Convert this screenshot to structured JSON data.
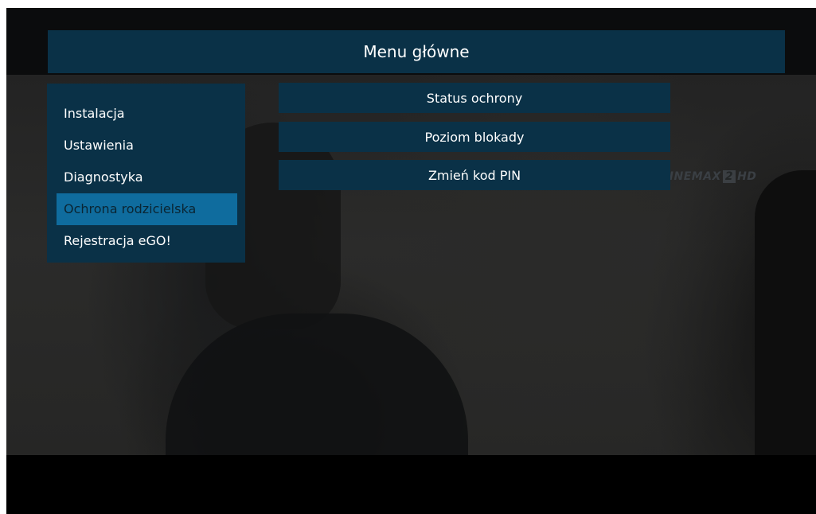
{
  "header": {
    "title": "Menu główne"
  },
  "sidebar": {
    "items": [
      {
        "label": "Instalacja"
      },
      {
        "label": "Ustawienia"
      },
      {
        "label": "Diagnostyka"
      },
      {
        "label": "Ochrona rodzicielska",
        "selected": true
      },
      {
        "label": "Rejestracja eGO!"
      }
    ]
  },
  "submenu": {
    "items": [
      {
        "label": "Status ochrony"
      },
      {
        "label": "Poziom blokady"
      },
      {
        "label": "Zmień kod PIN"
      }
    ]
  },
  "channel_logo": {
    "name": "CINEMAX",
    "number": "2",
    "suffix": "HD"
  },
  "colors": {
    "panel": "#0a3147",
    "selected": "#0f6c9e",
    "text": "#ffffff"
  }
}
